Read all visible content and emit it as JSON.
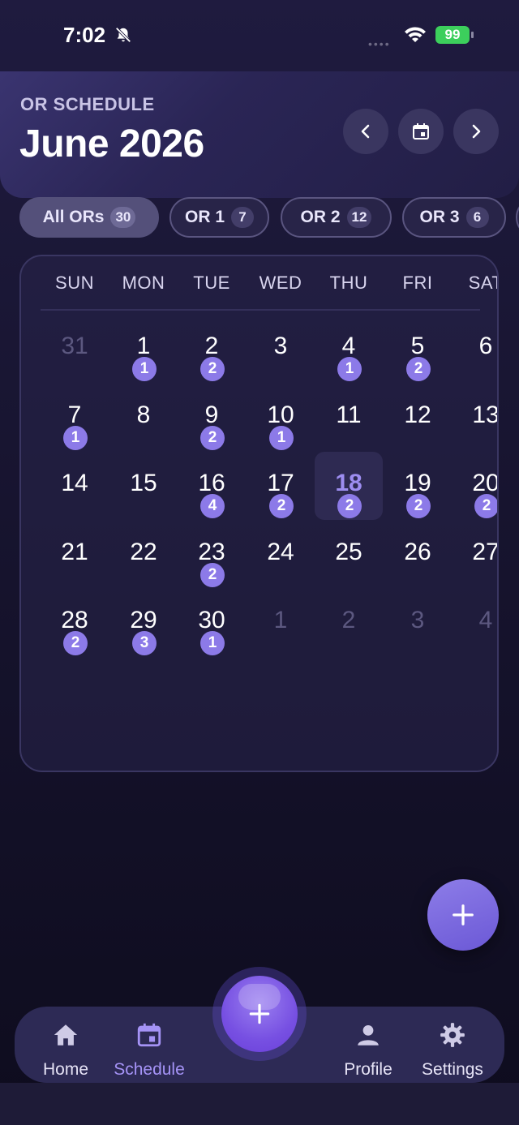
{
  "status_bar": {
    "time": "7:02",
    "battery": "99"
  },
  "header": {
    "subtitle": "OR SCHEDULE",
    "title": "June 2026",
    "prev_icon": "chevron-left-icon",
    "today_icon": "calendar-today-icon",
    "next_icon": "chevron-right-icon"
  },
  "filters": [
    {
      "label": "All ORs",
      "count": "30",
      "active": true
    },
    {
      "label": "OR 1",
      "count": "7",
      "active": false
    },
    {
      "label": "OR 2",
      "count": "12",
      "active": false
    },
    {
      "label": "OR 3",
      "count": "6",
      "active": false
    }
  ],
  "calendar": {
    "weekdays": [
      "SUN",
      "MON",
      "TUE",
      "WED",
      "THU",
      "FRI",
      "SAT"
    ],
    "days": [
      {
        "num": "31",
        "muted": true,
        "count": ""
      },
      {
        "num": "1",
        "muted": false,
        "count": "1"
      },
      {
        "num": "2",
        "muted": false,
        "count": "2"
      },
      {
        "num": "3",
        "muted": false,
        "count": ""
      },
      {
        "num": "4",
        "muted": false,
        "count": "1"
      },
      {
        "num": "5",
        "muted": false,
        "count": "2"
      },
      {
        "num": "6",
        "muted": false,
        "count": ""
      },
      {
        "num": "7",
        "muted": false,
        "count": "1"
      },
      {
        "num": "8",
        "muted": false,
        "count": ""
      },
      {
        "num": "9",
        "muted": false,
        "count": "2"
      },
      {
        "num": "10",
        "muted": false,
        "count": "1"
      },
      {
        "num": "11",
        "muted": false,
        "count": ""
      },
      {
        "num": "12",
        "muted": false,
        "count": ""
      },
      {
        "num": "13",
        "muted": false,
        "count": ""
      },
      {
        "num": "14",
        "muted": false,
        "count": ""
      },
      {
        "num": "15",
        "muted": false,
        "count": ""
      },
      {
        "num": "16",
        "muted": false,
        "count": "4"
      },
      {
        "num": "17",
        "muted": false,
        "count": "2"
      },
      {
        "num": "18",
        "muted": false,
        "count": "2",
        "today": true
      },
      {
        "num": "19",
        "muted": false,
        "count": "2"
      },
      {
        "num": "20",
        "muted": false,
        "count": "2"
      },
      {
        "num": "21",
        "muted": false,
        "count": ""
      },
      {
        "num": "22",
        "muted": false,
        "count": ""
      },
      {
        "num": "23",
        "muted": false,
        "count": "2"
      },
      {
        "num": "24",
        "muted": false,
        "count": ""
      },
      {
        "num": "25",
        "muted": false,
        "count": ""
      },
      {
        "num": "26",
        "muted": false,
        "count": ""
      },
      {
        "num": "27",
        "muted": false,
        "count": ""
      },
      {
        "num": "28",
        "muted": false,
        "count": "2"
      },
      {
        "num": "29",
        "muted": false,
        "count": "3"
      },
      {
        "num": "30",
        "muted": false,
        "count": "1"
      },
      {
        "num": "1",
        "muted": true,
        "count": ""
      },
      {
        "num": "2",
        "muted": true,
        "count": ""
      },
      {
        "num": "3",
        "muted": true,
        "count": ""
      },
      {
        "num": "4",
        "muted": true,
        "count": ""
      }
    ]
  },
  "fab_icon": "plus-icon",
  "bottom_nav": [
    {
      "label": "Home",
      "icon": "home-icon",
      "active": false
    },
    {
      "label": "Schedule",
      "icon": "calendar-icon",
      "active": true
    },
    {
      "label": "Profile",
      "icon": "person-icon",
      "active": false
    },
    {
      "label": "Settings",
      "icon": "gear-icon",
      "active": false
    }
  ],
  "colors": {
    "accent": "#8c7ae8",
    "active_tab": "#a593f6",
    "battery": "#3ccf5c"
  }
}
